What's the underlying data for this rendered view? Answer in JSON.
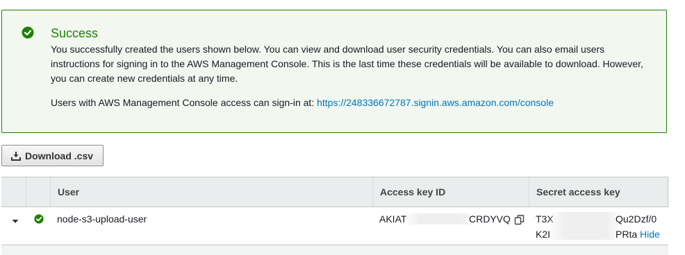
{
  "alert": {
    "icon": "check-circle-icon",
    "title": "Success",
    "body": "You successfully created the users shown below. You can view and download user security credentials. You can also email users instructions for signing in to the AWS Management Console. This is the last time these credentials will be available to download. However, you can create new credentials at any time.",
    "signin_prefix": "Users with AWS Management Console access can sign-in at: ",
    "signin_url": "https://248336672787.signin.aws.amazon.com/console",
    "accent_color": "#1d8102"
  },
  "toolbar": {
    "download_label": "Download .csv",
    "download_icon": "download-icon"
  },
  "table": {
    "columns": [
      "User",
      "Access key ID",
      "Secret access key"
    ],
    "rows": [
      {
        "user": "node-s3-upload-user",
        "access_key_start": "AKIAT",
        "access_key_end": "CRDYVQ",
        "secret_line1_start": "T3X",
        "secret_line1_end": "Qu2Dzf/0",
        "secret_line2_start": "K2I",
        "secret_line2_end": "PRta",
        "hide_label": "Hide",
        "status_icon": "check-circle-icon"
      }
    ]
  },
  "link_color": "#0073bb"
}
